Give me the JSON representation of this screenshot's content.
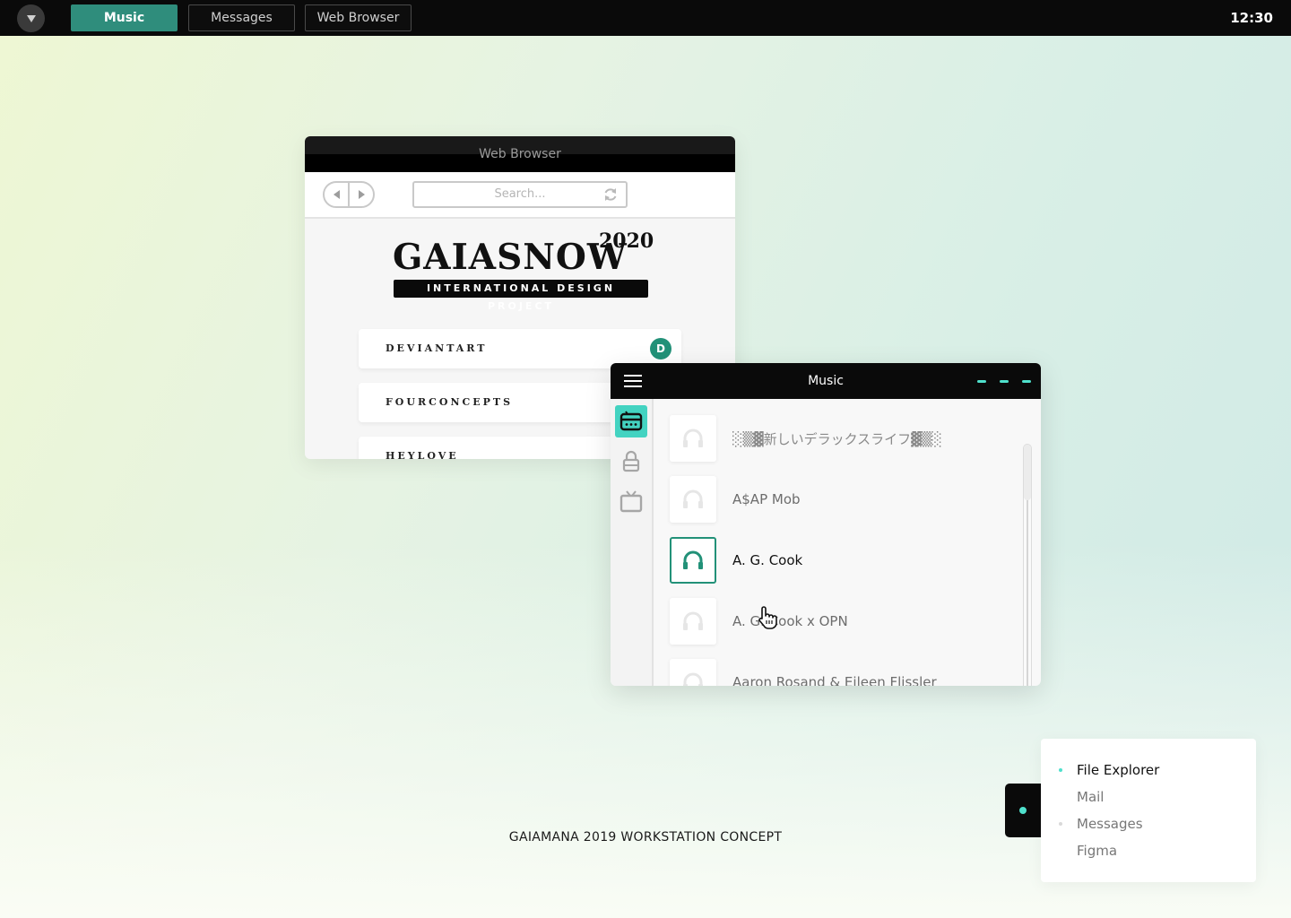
{
  "taskbar": {
    "menu_icon": "triangle-down-icon",
    "tasks": [
      {
        "label": "Music",
        "active": true
      },
      {
        "label": "Messages",
        "active": false
      },
      {
        "label": "Web Browser",
        "active": false
      }
    ],
    "clock": "12:30"
  },
  "browser": {
    "title": "Web Browser",
    "search_placeholder": "Search...",
    "site": {
      "brand": "GAIASNOW",
      "year": "2020",
      "subtitle": "INTERNATIONAL DESIGN PROJECT",
      "cards": [
        {
          "label": "DEVIANTART",
          "badge": "D"
        },
        {
          "label": "FOURCONCEPTS",
          "badge": ""
        },
        {
          "label": "HEYLOVE",
          "badge": ""
        }
      ]
    }
  },
  "music": {
    "title": "Music",
    "sidebar_icons": [
      "radio-icon",
      "lock-icon",
      "tv-icon"
    ],
    "tracks": [
      {
        "name": "░▒▓新しいデラックスライフ▓▒░",
        "active": false
      },
      {
        "name": "A$AP Mob",
        "active": false
      },
      {
        "name": "A. G. Cook",
        "active": true
      },
      {
        "name": "A. G. Cook x OPN",
        "active": false
      },
      {
        "name": "Aaron Rosand & Eileen Flissler",
        "active": false
      }
    ]
  },
  "caption": "GAIAMANA 2019 WORKSTATION CONCEPT",
  "switcher": {
    "items": [
      {
        "label": "File Explorer",
        "current": true,
        "bullet": "#4fe0cc"
      },
      {
        "label": "Mail",
        "current": false,
        "bullet": ""
      },
      {
        "label": "Messages",
        "current": false,
        "bullet": "#d9d9d9"
      },
      {
        "label": "Figma",
        "current": false,
        "bullet": ""
      }
    ]
  },
  "colors": {
    "accent": "#229178",
    "accent_light": "#4fe0cc",
    "taskbar_active": "#2f8d7c"
  }
}
